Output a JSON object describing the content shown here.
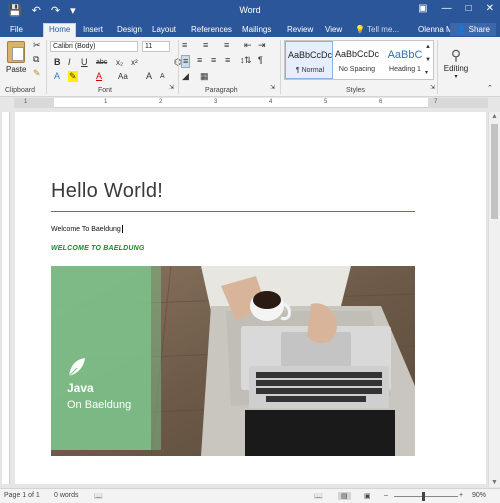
{
  "app": {
    "window_title": "Word",
    "user": "Olenna M..."
  },
  "qat": {
    "save_icon": "save-icon",
    "undo_icon": "undo-icon",
    "redo_icon": "redo-icon"
  },
  "tabs": {
    "file": "File",
    "home": "Home",
    "insert": "Insert",
    "design": "Design",
    "layout": "Layout",
    "references": "References",
    "mailings": "Mailings",
    "review": "Review",
    "view": "View",
    "tell_me": "Tell me...",
    "share": "Share"
  },
  "ribbon": {
    "clipboard": {
      "paste": "Paste",
      "label": "Clipboard"
    },
    "font": {
      "name": "Calibri (Body)",
      "size": "11",
      "label": "Font",
      "bold": "B",
      "italic": "I",
      "underline": "U",
      "strike": "abc",
      "subscript": "x₂",
      "superscript": "x²",
      "grow": "A",
      "shrink": "A",
      "case": "Aa",
      "clear": "A"
    },
    "paragraph": {
      "label": "Paragraph"
    },
    "styles": {
      "label": "Styles",
      "items": [
        {
          "sample": "AaBbCcDc",
          "name": "¶ Normal"
        },
        {
          "sample": "AaBbCcDc",
          "name": "No Spacing"
        },
        {
          "sample": "AaBbC",
          "name": "Heading 1"
        }
      ]
    },
    "editing": {
      "label": "Editing"
    }
  },
  "ruler": {
    "numbers": [
      "1",
      "1",
      "2",
      "3",
      "4",
      "5",
      "6",
      "7"
    ]
  },
  "document": {
    "title": "Hello World!",
    "paragraph": "Welcome To Baeldung",
    "styled_line": "WELCOME TO BAELDUNG",
    "image_text": {
      "line1": "Java",
      "line2": "On Baeldung"
    }
  },
  "status": {
    "page": "Page 1 of 1",
    "words": "0 words",
    "zoom": "90%"
  },
  "colors": {
    "accent": "#2b579a",
    "heading_rule": "#4472c4",
    "green_text": "#1c8a2c",
    "logo_green": "#7dc089"
  }
}
